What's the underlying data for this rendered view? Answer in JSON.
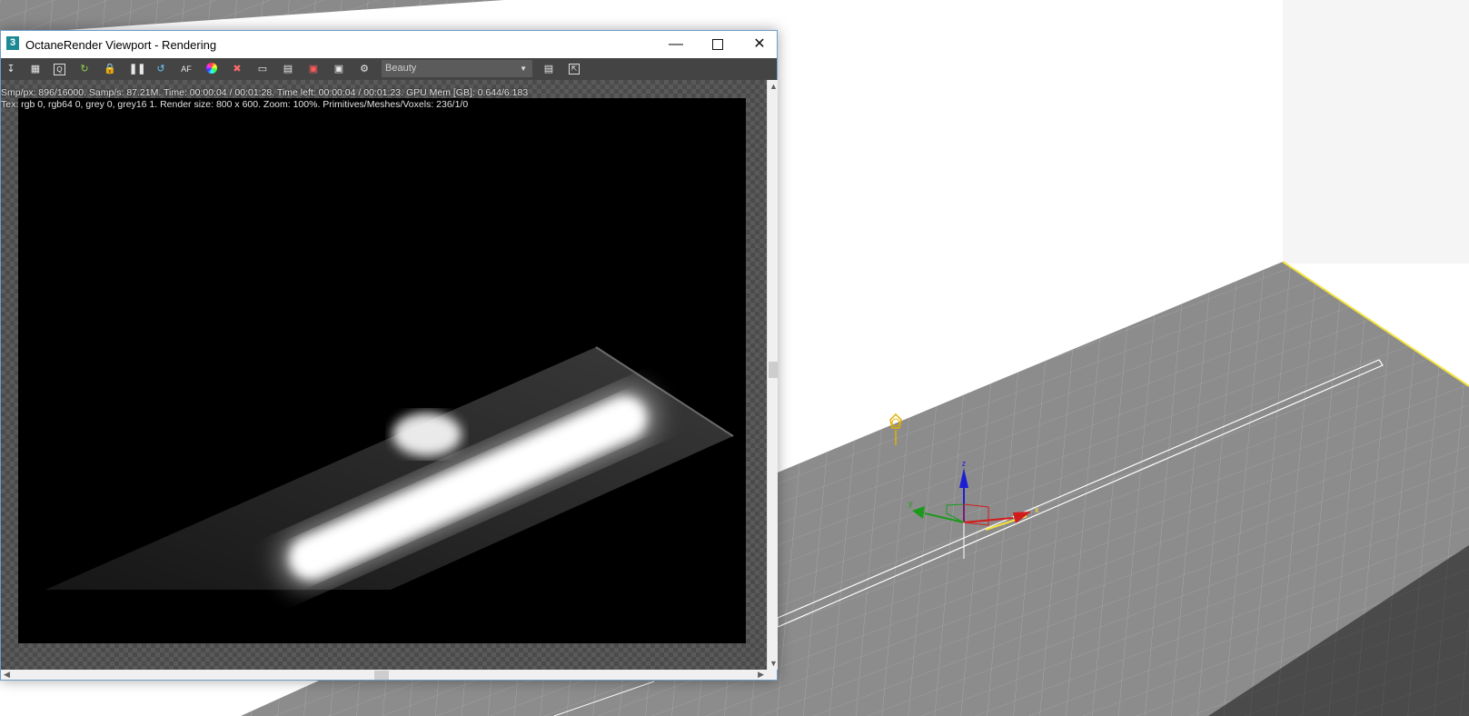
{
  "window": {
    "title": "OctaneRender Viewport - Rendering",
    "app_icon_text": "3",
    "minimize_icon": "minimize-icon",
    "maximize_icon": "maximize-icon",
    "close_icon": "close-icon"
  },
  "toolbar": {
    "icons": [
      "import-icon",
      "clipboard-icon",
      "zoom-region-icon",
      "refresh-icon",
      "lock-icon",
      "pause-icon",
      "restart-icon",
      "af-focus-icon",
      "color-picker-icon",
      "clear-icon",
      "monitor-icon",
      "film-icon",
      "camera-red-icon",
      "camera-icon",
      "settings-icon"
    ],
    "render_pass": "Beauty",
    "right_icons": [
      "table-icon",
      "export-icon"
    ]
  },
  "status": {
    "line1": "Smp/px: 896/16000.   Samp/s: 87.21M.   Time: 00:00:04 / 00:01:28.   Time left: 00:00:04 / 00:01:23.   GPU Mem [GB]: 0.644/6.183",
    "line2": "Tex: rgb 0, rgb64 0, grey 0, grey16 1.   Render size: 800 x 600.   Zoom: 100%.   Primitives/Meshes/Voxels: 236/1/0"
  },
  "gizmo": {
    "x_label": "x",
    "y_label": "y",
    "z_label": "z"
  },
  "colors": {
    "grid_plane": "#8a8a8a",
    "dark_plane": "#4a4a4a",
    "selection": "#f4e33c"
  }
}
